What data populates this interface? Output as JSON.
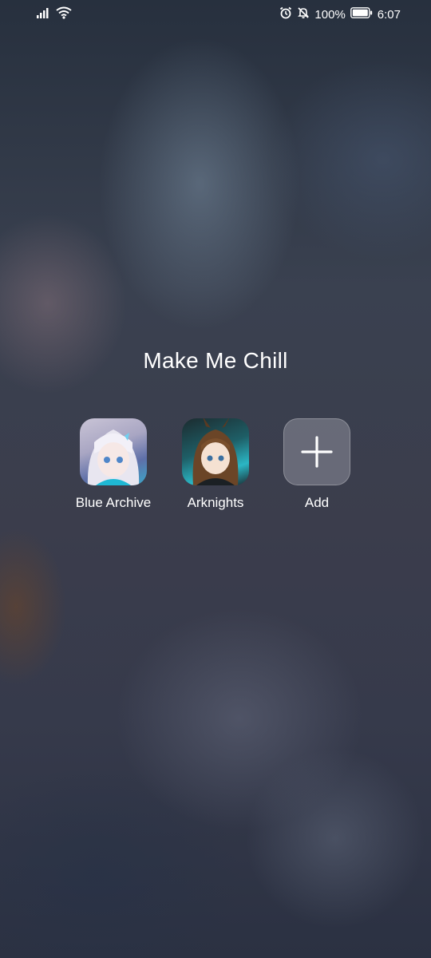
{
  "status_bar": {
    "battery": "100%",
    "time": "6:07",
    "icons": [
      "signal-icon",
      "wifi-icon",
      "alarm-icon",
      "mute-icon",
      "battery-icon"
    ]
  },
  "folder": {
    "title": "Make Me Chill",
    "apps": [
      {
        "label": "Blue Archive",
        "icon": "blue-archive-app-icon"
      },
      {
        "label": "Arknights",
        "icon": "arknights-app-icon"
      },
      {
        "label": "Add",
        "icon": "plus-icon"
      }
    ]
  }
}
